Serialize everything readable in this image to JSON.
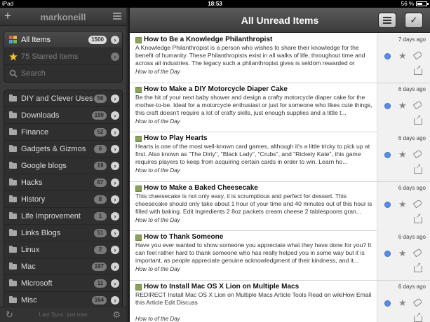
{
  "status_bar": {
    "device": "iPad",
    "time": "18:53",
    "battery": "56 %",
    "battery_fill": 0.56
  },
  "sidebar": {
    "username": "markoneill",
    "top_items": [
      {
        "label": "All Items",
        "count": "1500",
        "icon": "rss-icon",
        "selected": true
      },
      {
        "label": "75 Starred Items",
        "count": "",
        "icon": "star-icon",
        "selected": false
      },
      {
        "label": "Search",
        "count": "",
        "icon": "search-icon",
        "selected": false
      }
    ],
    "folders": [
      {
        "label": "DIY and Clever Uses",
        "count": "56"
      },
      {
        "label": "Downloads",
        "count": "190"
      },
      {
        "label": "Finance",
        "count": "52"
      },
      {
        "label": "Gadgets & Gizmos",
        "count": "6"
      },
      {
        "label": "Google blogs",
        "count": "19"
      },
      {
        "label": "Hacks",
        "count": "67"
      },
      {
        "label": "History",
        "count": "8"
      },
      {
        "label": "Life Improvement",
        "count": "1"
      },
      {
        "label": "Links Blogs",
        "count": "51"
      },
      {
        "label": "Linux",
        "count": "2"
      },
      {
        "label": "Mac",
        "count": "197"
      },
      {
        "label": "Microsoft",
        "count": "11"
      },
      {
        "label": "Misc",
        "count": "164"
      }
    ],
    "footer": {
      "sync_text": "Last Sync: just now"
    }
  },
  "main": {
    "title": "All Unread Items",
    "articles": [
      {
        "title": "How to Be a Knowledge Philanthropist",
        "snippet": "A Knowledge Philanthropist is a person who wishes to share their knowledge for the benefit of humanity. These Philanthropists exist in all walks of life, throughout time and across all industries. The legacy such a philanthropist gives is seldom rewarded or notic...",
        "source": "How to of the Day",
        "age": "7 days ago"
      },
      {
        "title": "How to Make a DIY Motorcycle Diaper Cake",
        "snippet": "Be the hit of your next baby shower and design a crafty motorcycle diaper cake for the mother-to-be. Ideal for a motorcycle enthusiast or just for someone who likes cute things, this craft doesn't require a lot of crafty skills, just enough supplies and a little t...",
        "source": "How to of the Day",
        "age": "6 days ago"
      },
      {
        "title": "How to Play Hearts",
        "snippet": "Hearts is one of the most well-known card games, although it's a little tricky to pick up at first. Also known as \"The Dirty\", \"Black Lady\", \"Crubs\", and \"Rickety Kate\", this game requires players to keep from acquiring certain cards in order to win. Learn ho...",
        "source": "How to of the Day",
        "age": "6 days ago"
      },
      {
        "title": "How to Make a Baked Cheesecake",
        "snippet": "This cheesecake is not only easy, it is scrumptious and perfect for dessert. This cheesecake should only take about 1 hour of your time and 40 minutes out of this hour is filled with baking. Edit Ingredients 2 8oz packets cream cheese 2 tablespoons gran...",
        "source": "How to of the Day",
        "age": "6 days ago"
      },
      {
        "title": "How to Thank Someone",
        "snippet": "Have you ever wanted to show someone you appreciate what they have done for you? It can feel rather hard to thank someone who has really helped you in some way but it is important, as people appreciate genuine acknowledgment of their kindness, and it...",
        "source": "How to of the Day",
        "age": "6 days ago"
      },
      {
        "title": "How to Install Mac OS X Lion on Multiple Macs",
        "snippet": "REDIRECT Install Mac OS X Lion on Multiple Macs Article Tools Read on wikiHow Email this Article Edit Discuss",
        "source": "How to of the Day",
        "age": "6 days ago"
      }
    ]
  },
  "colors": {
    "unread_dot": "#5a8ee6",
    "favicon": "#8aa25a"
  }
}
